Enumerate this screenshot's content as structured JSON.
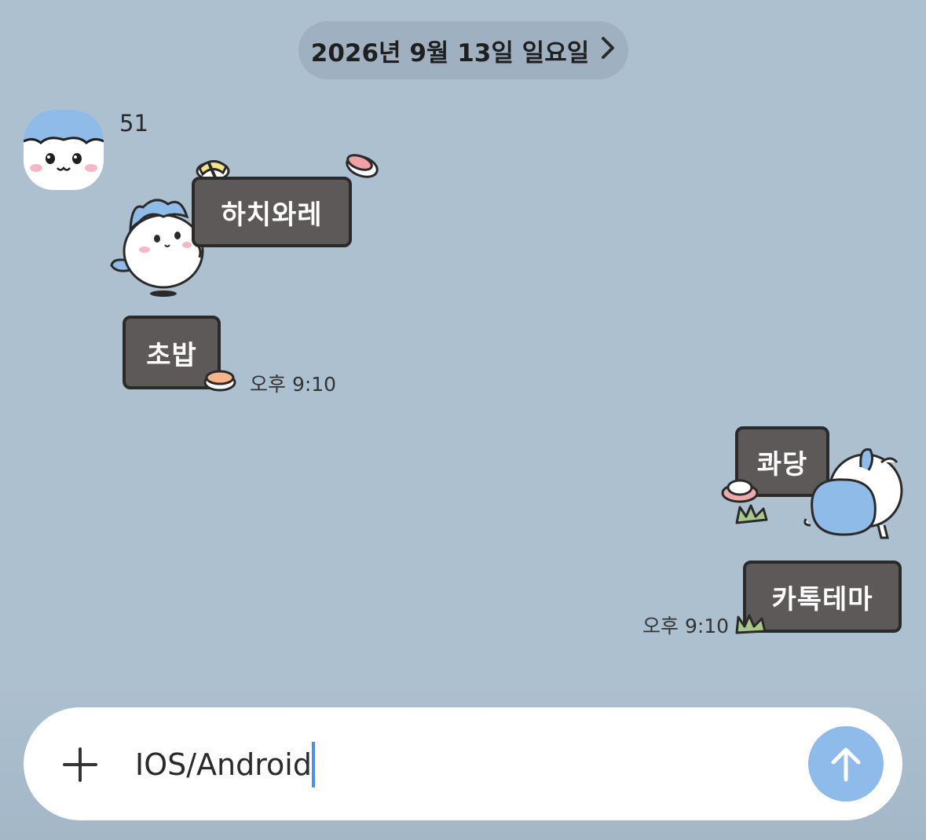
{
  "header": {
    "date_label": "2026년 9월 13일 일요일",
    "chevron": "›"
  },
  "chat": {
    "sender": {
      "name": "51",
      "avatar_icon": "hachiware-avatar-icon"
    },
    "incoming": [
      {
        "text": "하치와레"
      },
      {
        "text": "초밥",
        "time": "오후 9:10"
      }
    ],
    "outgoing": [
      {
        "text": "콰당"
      },
      {
        "text": "카톡테마",
        "time": "오후 9:10"
      }
    ]
  },
  "composer": {
    "plus_icon": "plus-icon",
    "input_value": "IOS/Android",
    "send_icon": "arrow-up-icon"
  },
  "colors": {
    "background": "#adc0d0",
    "bubble": "#5c5958",
    "send_button": "#8fbbea",
    "date_pill": "#9fb1c1"
  }
}
